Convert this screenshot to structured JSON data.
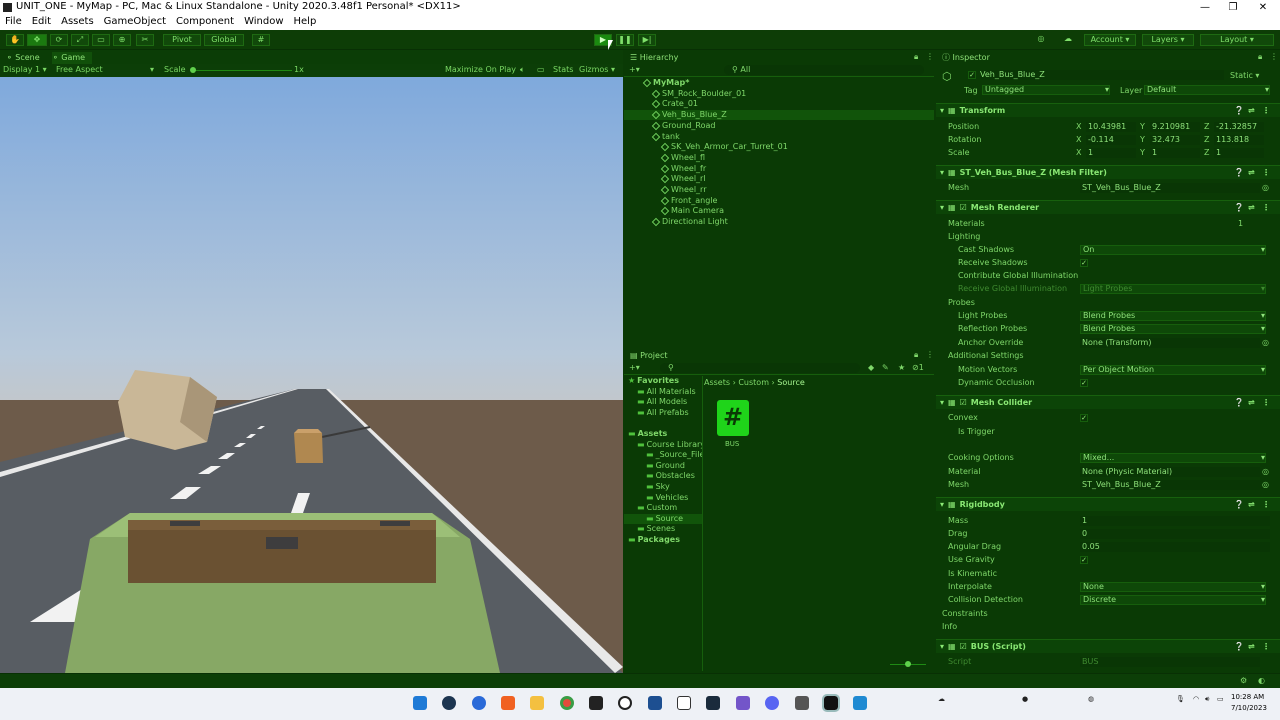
{
  "window": {
    "title": "UNIT_ONE - MyMap - PC, Mac & Linux Standalone - Unity 2020.3.48f1 Personal* <DX11>",
    "min": "—",
    "max": "❐",
    "close": "✕"
  },
  "menu": [
    "File",
    "Edit",
    "Assets",
    "GameObject",
    "Component",
    "Window",
    "Help"
  ],
  "toolbar": {
    "pivot": "Pivot",
    "global": "Global",
    "account": "Account",
    "layers": "Layers",
    "layout": "Layout"
  },
  "scene_tabs": {
    "scene": "Scene",
    "game": "Game"
  },
  "gamebar": {
    "display": "Display 1",
    "aspect": "Free Aspect",
    "scale": "Scale",
    "scale_value": "1x",
    "maximize": "Maximize On Play",
    "stats": "Stats",
    "gizmos": "Gizmos"
  },
  "hierarchy": {
    "tab": "Hierarchy",
    "search": "All",
    "rows": [
      {
        "label": "MyMap*",
        "indent": 0,
        "bold": true
      },
      {
        "label": "SM_Rock_Boulder_01",
        "indent": 1
      },
      {
        "label": "Crate_01",
        "indent": 1
      },
      {
        "label": "Veh_Bus_Blue_Z",
        "indent": 1,
        "selected": true
      },
      {
        "label": "Ground_Road",
        "indent": 1
      },
      {
        "label": "tank",
        "indent": 1
      },
      {
        "label": "SK_Veh_Armor_Car_Turret_01",
        "indent": 2
      },
      {
        "label": "Wheel_fl",
        "indent": 2
      },
      {
        "label": "Wheel_fr",
        "indent": 2
      },
      {
        "label": "Wheel_rl",
        "indent": 2
      },
      {
        "label": "Wheel_rr",
        "indent": 2
      },
      {
        "label": "Front_angle",
        "indent": 2
      },
      {
        "label": "Main Camera",
        "indent": 2
      },
      {
        "label": "Directional Light",
        "indent": 1
      }
    ]
  },
  "project": {
    "tab": "Project",
    "tree": [
      {
        "label": "Favorites",
        "indent": 0,
        "bold": true
      },
      {
        "label": "All Materials",
        "indent": 1
      },
      {
        "label": "All Models",
        "indent": 1
      },
      {
        "label": "All Prefabs",
        "indent": 1
      },
      {
        "label": "",
        "indent": 0
      },
      {
        "label": "Assets",
        "indent": 0,
        "bold": true
      },
      {
        "label": "Course Library",
        "indent": 1
      },
      {
        "label": "_Source_Files",
        "indent": 2
      },
      {
        "label": "Ground",
        "indent": 2
      },
      {
        "label": "Obstacles",
        "indent": 2
      },
      {
        "label": "Sky",
        "indent": 2
      },
      {
        "label": "Vehicles",
        "indent": 2
      },
      {
        "label": "Custom",
        "indent": 1
      },
      {
        "label": "Source",
        "indent": 2,
        "selected": true
      },
      {
        "label": "Scenes",
        "indent": 1
      },
      {
        "label": "Packages",
        "indent": 0,
        "bold": true
      }
    ],
    "breadcrumb": [
      "Assets",
      "Custom",
      "Source"
    ],
    "asset_name": "BUS",
    "asset_glyph": "#"
  },
  "inspector": {
    "tab": "Inspector",
    "object_name": "Veh_Bus_Blue_Z",
    "static": "Static",
    "tag_label": "Tag",
    "tag": "Untagged",
    "layer_label": "Layer",
    "layer": "Default",
    "transform": {
      "title": "Transform",
      "position": {
        "label": "Position",
        "x": "10.43981",
        "y": "9.210981",
        "z": "-21.32857"
      },
      "rotation": {
        "label": "Rotation",
        "x": "-0.114",
        "y": "32.473",
        "z": "113.818"
      },
      "scale": {
        "label": "Scale",
        "x": "1",
        "y": "1",
        "z": "1"
      }
    },
    "mesh_filter": {
      "title": "ST_Veh_Bus_Blue_Z (Mesh Filter)",
      "mesh_label": "Mesh",
      "mesh": "ST_Veh_Bus_Blue_Z"
    },
    "mesh_renderer": {
      "title": "Mesh Renderer",
      "materials": "Materials",
      "materials_count": "1",
      "lighting": "Lighting",
      "cast_shadows": "Cast Shadows",
      "cast_shadows_value": "On",
      "receive_shadows": "Receive Shadows",
      "contribute_gi": "Contribute Global Illumination",
      "receive_gi": "Receive Global Illumination",
      "receive_gi_value": "Light Probes",
      "probes": "Probes",
      "light_probes": "Light Probes",
      "light_probes_value": "Blend Probes",
      "reflection_probes": "Reflection Probes",
      "reflection_probes_value": "Blend Probes",
      "anchor_override": "Anchor Override",
      "anchor_override_value": "None (Transform)",
      "additional": "Additional Settings",
      "motion_vectors": "Motion Vectors",
      "motion_vectors_value": "Per Object Motion",
      "dynamic_occlusion": "Dynamic Occlusion"
    },
    "mesh_collider": {
      "title": "Mesh Collider",
      "convex": "Convex",
      "is_trigger": "Is Trigger",
      "cooking": "Cooking Options",
      "cooking_value": "Mixed...",
      "material": "Material",
      "material_value": "None (Physic Material)",
      "mesh": "Mesh",
      "mesh_value": "ST_Veh_Bus_Blue_Z"
    },
    "rigidbody": {
      "title": "Rigidbody",
      "mass": "Mass",
      "mass_value": "1",
      "drag": "Drag",
      "drag_value": "0",
      "angular_drag": "Angular Drag",
      "angular_drag_value": "0.05",
      "use_gravity": "Use Gravity",
      "is_kinematic": "Is Kinematic",
      "interpolate": "Interpolate",
      "interpolate_value": "None",
      "collision": "Collision Detection",
      "collision_value": "Discrete",
      "constraints": "Constraints",
      "info": "Info"
    },
    "script": {
      "title": "BUS (Script)",
      "label": "Script",
      "value": "BUS"
    }
  },
  "taskbar": {
    "time": "10:28 AM",
    "date": "7/10/2023"
  },
  "colors": {
    "accent": "#1fd41a",
    "panel_bg": "#0a3a05",
    "sky": "#9dc0e6",
    "ground": "#6d5b4a",
    "road": "#585d63",
    "bus_roof": "#6a5132"
  }
}
